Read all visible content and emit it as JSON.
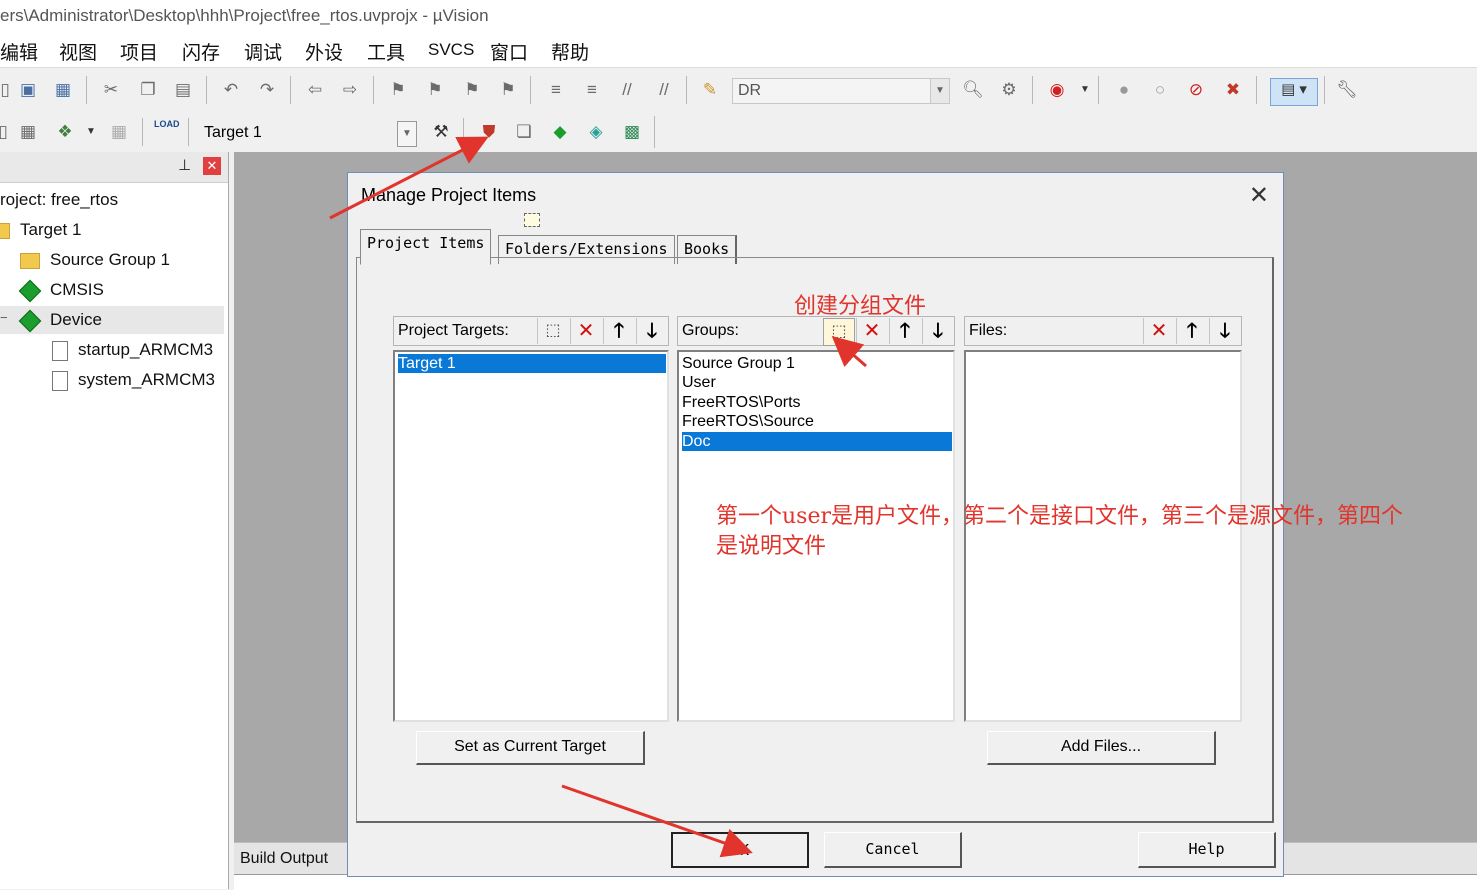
{
  "window": {
    "title": "ers\\Administrator\\Desktop\\hhh\\Project\\free_rtos.uvprojx - µVision"
  },
  "menu": [
    "编辑",
    "视图",
    "项目",
    "闪存",
    "调试",
    "外设",
    "工具",
    "SVCS",
    "窗口",
    "帮助"
  ],
  "toolbar": {
    "find_combo_value": "DR",
    "target_combo_value": "Target 1",
    "load_label": "LOAD"
  },
  "project_panel": {
    "pin_icon": "pin-icon",
    "close_icon": "close-icon",
    "tree": [
      {
        "label": "roject: free_rtos",
        "icon": "project-icon"
      },
      {
        "label": "Target 1",
        "icon": "folder-icon"
      },
      {
        "label": "Source Group 1",
        "icon": "folder-icon"
      },
      {
        "label": "CMSIS",
        "icon": "component-icon"
      },
      {
        "label": "Device",
        "icon": "component-icon"
      },
      {
        "label": "startup_ARMCM3",
        "icon": "file-icon"
      },
      {
        "label": "system_ARMCM3",
        "icon": "file-icon"
      }
    ],
    "expand_glyph": "−"
  },
  "build_output": {
    "label": "Build Output"
  },
  "dialog": {
    "title": "Manage Project Items",
    "close_glyph": "✕",
    "tabs": [
      "Project Items",
      "Folders/Extensions",
      "Books"
    ],
    "active_tab": "Project Items",
    "targets": {
      "header": "Project Targets:",
      "items": [
        "Target 1"
      ],
      "selected": "Target 1"
    },
    "groups": {
      "header": "Groups:",
      "items": [
        "Source Group 1",
        "User",
        "FreeRTOS\\Ports",
        "FreeRTOS\\Source",
        "Doc"
      ],
      "selected": "Doc"
    },
    "files": {
      "header": "Files:",
      "items": []
    },
    "header_glyphs": {
      "new": "⬚",
      "delete": "✕",
      "up": "🡑",
      "down": "🡓"
    },
    "set_current_label": "Set as Current Target",
    "add_files_label": "Add Files...",
    "ok_label": "OK",
    "cancel_label": "Cancel",
    "help_label": "Help"
  },
  "annotations": {
    "create_group": "创建分组文件",
    "note_line1": "第一个user是用户文件，第二个是接口文件，第三个是源文件，第四个",
    "note_line2": "是说明文件",
    "color": "#e0342c"
  }
}
